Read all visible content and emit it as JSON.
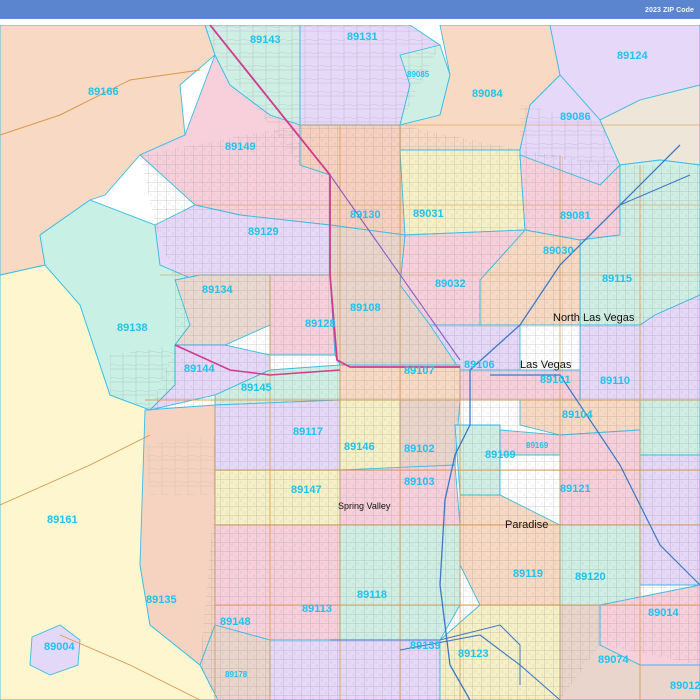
{
  "header": {
    "title": "2023 ZIP Code"
  },
  "places": [
    {
      "id": "north-las-vegas",
      "label": "North Las Vegas"
    },
    {
      "id": "las-vegas",
      "label": "Las Vegas"
    },
    {
      "id": "spring-valley",
      "label": "Spring Valley"
    },
    {
      "id": "paradise",
      "label": "Paradise"
    }
  ],
  "zip_labels": [
    "89143",
    "89131",
    "89085",
    "89124",
    "89166",
    "89084",
    "89086",
    "89149",
    "89031",
    "89081",
    "89130",
    "89129",
    "89030",
    "89115",
    "89032",
    "89134",
    "89108",
    "89128",
    "89138",
    "89106",
    "89144",
    "89107",
    "89101",
    "89110",
    "89145",
    "89104",
    "89117",
    "89146",
    "89102",
    "89169",
    "89109",
    "89147",
    "89103",
    "89121",
    "89161",
    "89119",
    "89118",
    "89120",
    "89135",
    "89113",
    "89014",
    "89148",
    "89004",
    "89139",
    "89123",
    "89074",
    "89178",
    "89012"
  ],
  "colors": {
    "header": "#5b86cf",
    "zip_label": "#1ec3ee",
    "zone_boundary": "#38bde6",
    "street": "#8a8a8a",
    "highway": "#cf3d8f",
    "arterial": "#d9984c",
    "river_trail": "#3a78c6"
  }
}
